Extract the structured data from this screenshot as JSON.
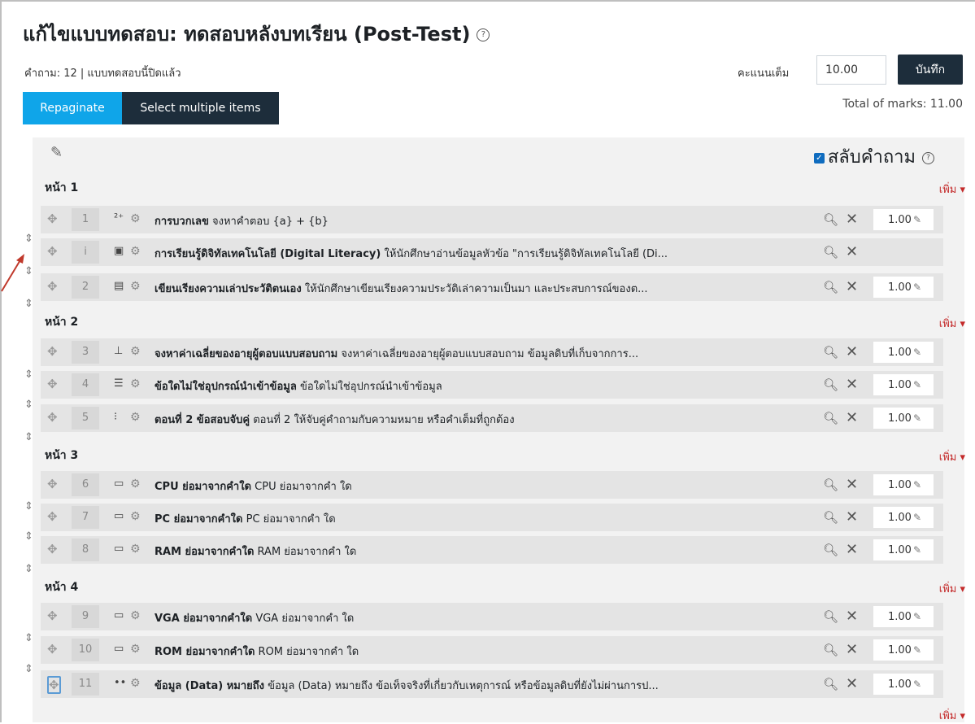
{
  "header": {
    "title": "แก้ไขแบบทดสอบ: ทดสอบหลังบทเรียน (Post-Test)",
    "help_icon": "question-circle-icon",
    "info": "คำถาม: 12 | แบบทดสอบนี้ปิดแล้ว",
    "max_grade_label": "คะแนนเต็ม",
    "max_grade_value": "10.00",
    "save_label": "บันทึก",
    "total_marks": "Total of marks: 11.00"
  },
  "toolbar": {
    "repaginate_label": "Repaginate",
    "select_multiple_label": "Select multiple items"
  },
  "shuffle": {
    "label": "สลับคำถาม",
    "checked": true
  },
  "add_label": "เพิ่ม ▾",
  "pages": [
    {
      "label": "หน้า 1"
    },
    {
      "label": "หน้า 2"
    },
    {
      "label": "หน้า 3"
    },
    {
      "label": "หน้า 4"
    }
  ],
  "questions": [
    {
      "num": "1",
      "type_icon": "calculated-icon",
      "name": "การบวกเลข",
      "text": "จงหาคำตอบ {a} + {b}",
      "mark": "1.00"
    },
    {
      "num": "i",
      "type_icon": "description-icon",
      "name": "การเรียนรู้ดิจิทัลเทคโนโลยี (Digital Literacy)",
      "text": "ให้นักศึกษาอ่านข้อมูลหัวข้อ \"การเรียนรู้ดิจิทัลเทคโนโลยี (Di...",
      "mark": ""
    },
    {
      "num": "2",
      "type_icon": "essay-icon",
      "name": "เขียนเรียงความเล่าประวัติตนเอง",
      "text": "ให้นักศึกษาเขียนเรียงความประวัติเล่าความเป็นมา และประสบการณ์ของต...",
      "mark": "1.00"
    },
    {
      "num": "3",
      "type_icon": "numerical-icon",
      "name": "จงหาค่าเฉลี่ยของอายุผู้ตอบแบบสอบถาม",
      "text": "จงหาค่าเฉลี่ยของอายุผู้ตอบแบบสอบถาม ข้อมูลดิบที่เก็บจากการ...",
      "mark": "1.00"
    },
    {
      "num": "4",
      "type_icon": "multichoice-icon",
      "name": "ข้อใดไม่ใช่อุปกรณ์นำเข้าข้อมูล",
      "text": "ข้อใดไม่ใช่อุปกรณ์นำเข้าข้อมูล",
      "mark": "1.00"
    },
    {
      "num": "5",
      "type_icon": "match-icon",
      "name": "ตอนที่ 2 ข้อสอบจับคู่",
      "text": "ตอนที่ 2 ให้จับคู่คำถามกับความหมาย หรือคำเต็มที่ถูกต้อง",
      "mark": "1.00"
    },
    {
      "num": "6",
      "type_icon": "shortanswer-icon",
      "name": "CPU ย่อมาจากคำใด",
      "text": "CPU ย่อมาจากคำ ใด",
      "mark": "1.00"
    },
    {
      "num": "7",
      "type_icon": "shortanswer-icon",
      "name": "PC ย่อมาจากคำใด",
      "text": "PC  ย่อมาจากคำ ใด",
      "mark": "1.00"
    },
    {
      "num": "8",
      "type_icon": "shortanswer-icon",
      "name": "RAM ย่อมาจากคำใด",
      "text": "RAM  ย่อมาจากคำ ใด",
      "mark": "1.00"
    },
    {
      "num": "9",
      "type_icon": "shortanswer-icon",
      "name": "VGA ย่อมาจากคำใด",
      "text": "VGA  ย่อมาจากคำ ใด",
      "mark": "1.00"
    },
    {
      "num": "10",
      "type_icon": "shortanswer-icon",
      "name": "ROM ย่อมาจากคำใด",
      "text": "ROM  ย่อมาจากคำ ใด",
      "mark": "1.00"
    },
    {
      "num": "11",
      "type_icon": "gapselect-icon",
      "name": "ข้อมูล (Data) หมายถึง",
      "text": "ข้อมูล (Data) หมายถึง ข้อเท็จจริงที่เกี่ยวกับเหตุการณ์ หรือข้อมูลดิบที่ยังไม่ผ่านการป...",
      "mark": "1.00"
    }
  ]
}
